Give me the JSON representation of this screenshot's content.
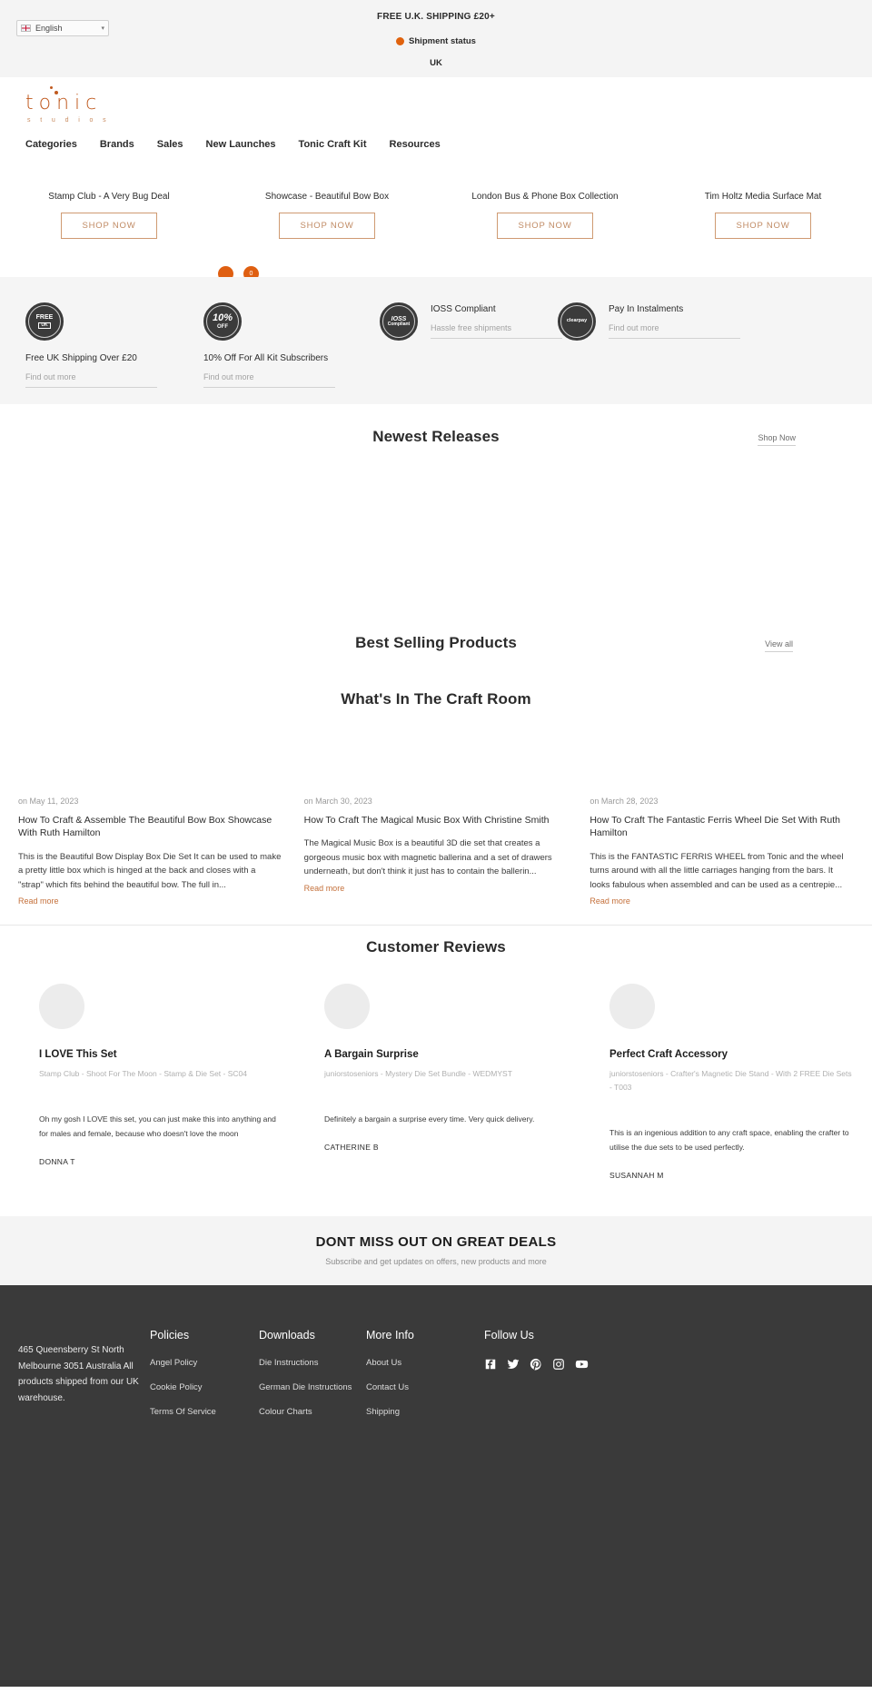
{
  "announcement": {
    "shipping_text": "FREE U.K. SHIPPING £20+",
    "language": "English",
    "language_caret": "▾",
    "shipment_status": "Shipment status",
    "shipment_country": "UK"
  },
  "header": {
    "logo_word": "tonic",
    "logo_sub": "s t u d i o s",
    "nav": [
      {
        "label": "Categories"
      },
      {
        "label": "Brands"
      },
      {
        "label": "Sales"
      },
      {
        "label": "New Launches"
      },
      {
        "label": "Tonic Craft Kit"
      },
      {
        "label": "Resources"
      }
    ],
    "cart_count": "0"
  },
  "promos": [
    {
      "title": "Stamp Club - A Very Bug Deal",
      "cta": "SHOP NOW"
    },
    {
      "title": "Showcase - Beautiful Bow Box",
      "cta": "SHOP NOW"
    },
    {
      "title": "London Bus & Phone Box Collection",
      "cta": "SHOP NOW"
    },
    {
      "title": "Tim Holtz Media Surface Mat",
      "cta": "SHOP NOW"
    }
  ],
  "benefits": [
    {
      "badge_line1": "FREE",
      "badge_line2": "UK",
      "title": "Free UK Shipping Over £20",
      "link": "Find out more"
    },
    {
      "badge_line1": "10%",
      "badge_line2": "OFF",
      "title": "10% Off For All Kit Subscribers",
      "link": "Find out more"
    },
    {
      "badge_line1": "IOSS",
      "badge_line2": "Compliant",
      "title": "IOSS Compliant",
      "link": "Hassle free shipments"
    },
    {
      "badge_line1": "clearpay",
      "badge_line2": "",
      "title": "Pay In Instalments",
      "link": "Find out more"
    }
  ],
  "sections": {
    "newest": {
      "title": "Newest Releases",
      "link": "Shop Now"
    },
    "bestselling": {
      "title": "Best Selling Products",
      "link": "View all"
    },
    "craftroom": {
      "title": "What's In The Craft Room"
    },
    "reviews": {
      "title": "Customer Reviews"
    }
  },
  "blog": [
    {
      "date": "on May 11, 2023",
      "title": "How To Craft & Assemble The Beautiful Bow Box Showcase With Ruth Hamilton",
      "excerpt": "This is the Beautiful Bow Display Box Die Set It can be used to make a pretty little box which is hinged at the back and closes with a \"strap\" which fits behind the beautiful bow. The full in...",
      "more": "Read more"
    },
    {
      "date": "on March 30, 2023",
      "title": "How To Craft The Magical Music Box With Christine Smith",
      "excerpt": "The Magical Music Box is a beautiful 3D die set that creates a gorgeous music box with magnetic ballerina and a set of drawers underneath, but don't think it just has to contain the ballerin...",
      "more": "Read more"
    },
    {
      "date": "on March 28, 2023",
      "title": "How To Craft The Fantastic Ferris Wheel Die Set With Ruth Hamilton",
      "excerpt": "This is the FANTASTIC FERRIS WHEEL from Tonic and the wheel turns around with all the little carriages hanging from the bars. It looks fabulous when assembled and can be used as a centrepie...",
      "more": "Read more"
    }
  ],
  "reviews": [
    {
      "title": "I LOVE This Set",
      "product": "Stamp Club - Shoot For The Moon - Stamp & Die Set - SC04",
      "body": "Oh my gosh I LOVE this set, you can just make this into anything and for males and female, because who doesn't love the moon",
      "author": "DONNA T"
    },
    {
      "title": "A Bargain Surprise",
      "product": "juniorstoseniors - Mystery Die Set Bundle - WEDMYST",
      "body": "Definitely a bargain a surprise every time. Very quick delivery.",
      "author": "CATHERINE B"
    },
    {
      "title": "Perfect Craft Accessory",
      "product": "juniorstoseniors - Crafter's Magnetic Die Stand - With 2 FREE Die Sets - T003",
      "body": "This is an ingenious addition to any craft space, enabling the crafter to utilise the due sets to be used perfectly.",
      "author": "SUSANNAH M"
    }
  ],
  "newsletter": {
    "title": "DONT MISS OUT ON GREAT DEALS",
    "subtitle": "Subscribe and get updates on offers, new products and more"
  },
  "footer": {
    "address": "465 Queensberry St North Melbourne 3051 Australia All products shipped from our UK warehouse.",
    "columns": [
      {
        "heading": "Policies",
        "links": [
          "Angel Policy",
          "Cookie Policy",
          "Terms Of Service"
        ]
      },
      {
        "heading": "Downloads",
        "links": [
          "Die Instructions",
          "German Die Instructions",
          "Colour Charts"
        ]
      },
      {
        "heading": "More Info",
        "links": [
          "About Us",
          "Contact Us",
          "Shipping"
        ]
      }
    ],
    "follow_heading": "Follow Us",
    "socials": [
      "facebook-icon",
      "twitter-icon",
      "pinterest-icon",
      "instagram-icon",
      "youtube-icon"
    ]
  },
  "colors": {
    "brand_orange": "#c05a1f",
    "accent_orange": "#df5f11",
    "cta_border": "#cf9a72",
    "footer_bg": "#3a3a3a",
    "strip_bg": "#f4f4f4"
  }
}
